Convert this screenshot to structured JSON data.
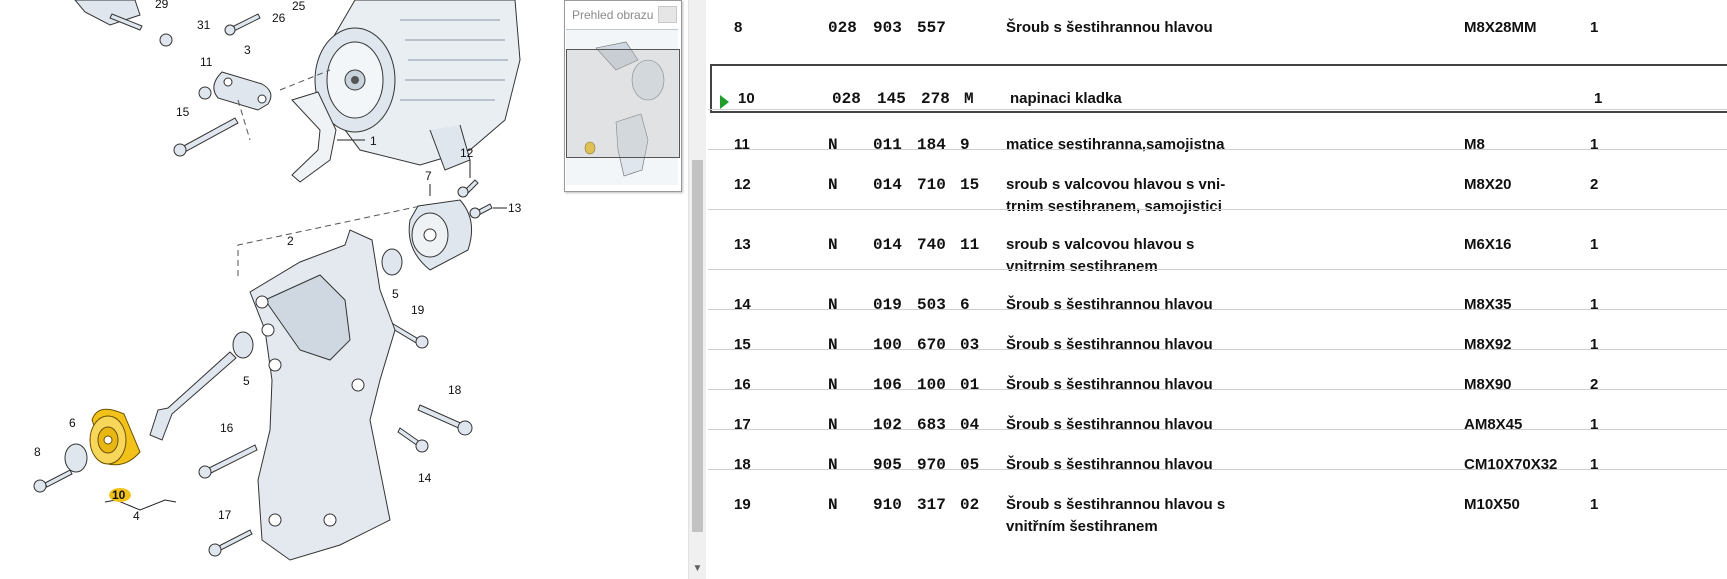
{
  "overview": {
    "title": "Prehled obrazu"
  },
  "diagram": {
    "callouts": [
      "29",
      "31",
      "26",
      "25",
      "3",
      "11",
      "15",
      "1",
      "12",
      "13",
      "7",
      "2",
      "5",
      "19",
      "5",
      "18",
      "6",
      "8",
      "16",
      "14",
      "10",
      "4",
      "17"
    ],
    "highlight_color": "#f2c21b"
  },
  "table": {
    "rows": [
      {
        "pos": "8",
        "p1": "028",
        "p2": "903",
        "p3": "557",
        "p4": "",
        "desc": "Šroub s šestihrannou hlavou",
        "spec": "M8X28MM",
        "qty": "1"
      },
      {
        "pos": "10",
        "p1": "028",
        "p2": "145",
        "p3": "278",
        "p4": "M",
        "desc": "napinaci kladka",
        "spec": "",
        "qty": "1",
        "selected": true
      },
      {
        "pos": "11",
        "p1": "N",
        "p2": "011",
        "p3": "184",
        "p4": "9",
        "desc": "matice sestihranna,samojistna",
        "spec": "M8",
        "qty": "1"
      },
      {
        "pos": "12",
        "p1": "N",
        "p2": "014",
        "p3": "710",
        "p4": "15",
        "desc": "sroub s valcovou hlavou s vni- trnim sestihranem, samojistici",
        "spec": "M8X20",
        "qty": "2"
      },
      {
        "pos": "13",
        "p1": "N",
        "p2": "014",
        "p3": "740",
        "p4": "11",
        "desc": "sroub s valcovou hlavou s vnitrnim sestihranem",
        "spec": "M6X16",
        "qty": "1"
      },
      {
        "pos": "14",
        "p1": "N",
        "p2": "019",
        "p3": "503",
        "p4": "6",
        "desc": "Šroub s šestihrannou hlavou",
        "spec": "M8X35",
        "qty": "1"
      },
      {
        "pos": "15",
        "p1": "N",
        "p2": "100",
        "p3": "670",
        "p4": "03",
        "desc": "Šroub s šestihrannou hlavou",
        "spec": "M8X92",
        "qty": "1"
      },
      {
        "pos": "16",
        "p1": "N",
        "p2": "106",
        "p3": "100",
        "p4": "01",
        "desc": "Šroub s šestihrannou hlavou",
        "spec": "M8X90",
        "qty": "2"
      },
      {
        "pos": "17",
        "p1": "N",
        "p2": "102",
        "p3": "683",
        "p4": "04",
        "desc": "Šroub s šestihrannou hlavou",
        "spec": "AM8X45",
        "qty": "1"
      },
      {
        "pos": "18",
        "p1": "N",
        "p2": "905",
        "p3": "970",
        "p4": "05",
        "desc": "Šroub s šestihrannou hlavou",
        "spec": "CM10X70X32",
        "qty": "1"
      },
      {
        "pos": "19",
        "p1": "N",
        "p2": "910",
        "p3": "317",
        "p4": "02",
        "desc": "Šroub s šestihrannou hlavou s vnitřním šestihranem",
        "spec": "M10X50",
        "qty": "1"
      }
    ]
  }
}
